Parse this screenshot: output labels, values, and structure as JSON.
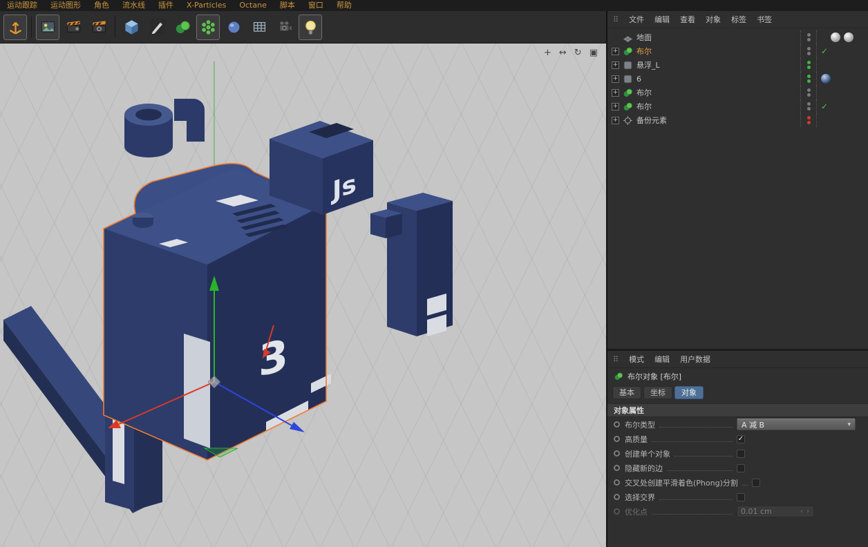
{
  "menubar": {
    "items": [
      "运动跟踪",
      "运动图形",
      "角色",
      "流水线",
      "插件",
      "X-Particles",
      "Octane",
      "脚本",
      "窗口",
      "帮助"
    ]
  },
  "toolbar": {
    "tools": [
      {
        "name": "move-tool"
      },
      {
        "name": "render-view"
      },
      {
        "name": "render-to-picture-viewer"
      },
      {
        "name": "render-settings"
      },
      {
        "name": "cube-primitive"
      },
      {
        "name": "pen-spline"
      },
      {
        "name": "boolean-generator"
      },
      {
        "name": "mograph-array"
      },
      {
        "name": "deformer"
      },
      {
        "name": "array-grid"
      },
      {
        "name": "camera"
      },
      {
        "name": "light"
      }
    ]
  },
  "viewport": {
    "nav_icons": [
      {
        "glyph": "+",
        "name": "pan-view"
      },
      {
        "glyph": "↔",
        "name": "zoom-view"
      },
      {
        "glyph": "↻",
        "name": "rotate-view"
      },
      {
        "glyph": "▣",
        "name": "toggle-view"
      }
    ],
    "model_labels": {
      "js": "Js",
      "three": "3"
    }
  },
  "object_manager": {
    "menu": [
      "文件",
      "编辑",
      "查看",
      "对象",
      "标签",
      "书签"
    ],
    "items": [
      {
        "name": "地面"
      },
      {
        "name": "布尔",
        "state": "selected",
        "tag": "check"
      },
      {
        "name": "悬浮_L"
      },
      {
        "name": "6"
      },
      {
        "name": "布尔"
      },
      {
        "name": "布尔",
        "tag": "check"
      },
      {
        "name": "备份元素"
      }
    ]
  },
  "attribute_manager": {
    "menu": [
      "模式",
      "编辑",
      "用户数据"
    ],
    "title": "布尔对象 [布尔]",
    "tabs": [
      "基本",
      "坐标",
      "对象"
    ],
    "active_tab": "对象",
    "section": "对象属性",
    "properties": [
      {
        "label": "布尔类型",
        "value": "A 减 B"
      },
      {
        "label": "高质量",
        "checked": true
      },
      {
        "label": "创建单个对象",
        "checked": false
      },
      {
        "label": "隐藏新的边",
        "checked": false
      },
      {
        "label": "交叉处创建平滑着色(Phong)分割",
        "checked": false
      },
      {
        "label": "选择交界",
        "checked": false
      },
      {
        "label": "优化点",
        "value": "0.01 cm",
        "disabled": true
      }
    ]
  },
  "icons": {
    "grip": "⠿",
    "plus": "+",
    "check": "✓",
    "dropdown_arrow": "▾",
    "spinner": "‹ ›"
  },
  "colors": {
    "menu_text": "#c9943e",
    "selection_outline": "#f07c30",
    "selected_object_text": "#eda14a",
    "model_top": "#3d5088",
    "model_left": "#2d3c6a",
    "model_right": "#242f58",
    "axis_x": "#d93a28",
    "axis_y": "#28b528",
    "axis_z": "#2f46d9",
    "tab_active": "#4e7096",
    "check_green": "#4fbf4f",
    "viewport_bg": "#c6c6c6"
  }
}
